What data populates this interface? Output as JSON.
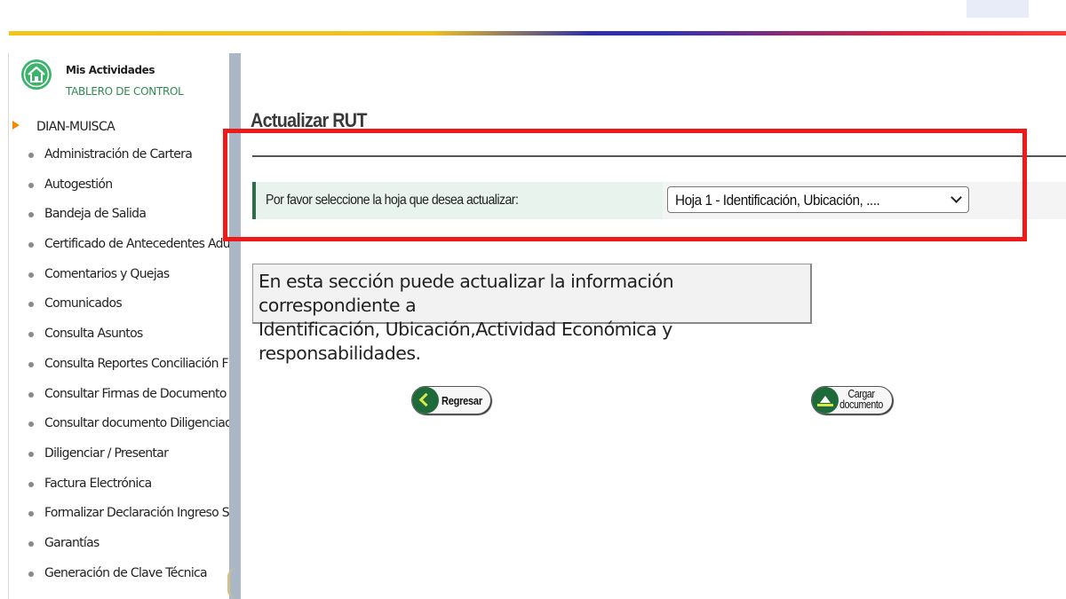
{
  "header": {
    "colors": {
      "band_yellow": "#f3c419",
      "band_blue": "#2d2fa8",
      "band_red": "#e0243a"
    }
  },
  "sidebar": {
    "home_icon": "house-icon",
    "title": "Mis Actividades",
    "subtitle": "TABLERO DE CONTROL",
    "root_label": "DIAN-MUISCA",
    "items": [
      {
        "label": "Administración de Cartera"
      },
      {
        "label": "Autogestión"
      },
      {
        "label": "Bandeja de Salida"
      },
      {
        "label": "Certificado de Antecedentes Adu"
      },
      {
        "label": "Comentarios y Quejas"
      },
      {
        "label": "Comunicados"
      },
      {
        "label": "Consulta Asuntos"
      },
      {
        "label": "Consulta Reportes Conciliación F"
      },
      {
        "label": "Consultar Firmas de Documento"
      },
      {
        "label": "Consultar documento Diligenciad"
      },
      {
        "label": "Diligenciar / Presentar"
      },
      {
        "label": "Factura Electrónica"
      },
      {
        "label": "Formalizar Declaración Ingreso S"
      },
      {
        "label": "Garantías"
      },
      {
        "label": "Generación de Clave Técnica"
      }
    ]
  },
  "main": {
    "title": "Actualizar RUT",
    "form": {
      "label": "Por favor seleccione la hoja que desea actualizar:",
      "selected": "Hoja 1 - Identificación, Ubicación, ...."
    },
    "info_line1": "En esta sección puede actualizar la información correspondiente a",
    "info_line2": "Identificación, Ubicación,Actividad Económica y responsabilidades.",
    "buttons": {
      "back_label": "Regresar",
      "back_icon": "chevron-left-icon",
      "upload_line1": "Cargar",
      "upload_line2": "documento",
      "upload_icon": "upload-icon"
    },
    "highlight_color": "#ee1a1a"
  }
}
